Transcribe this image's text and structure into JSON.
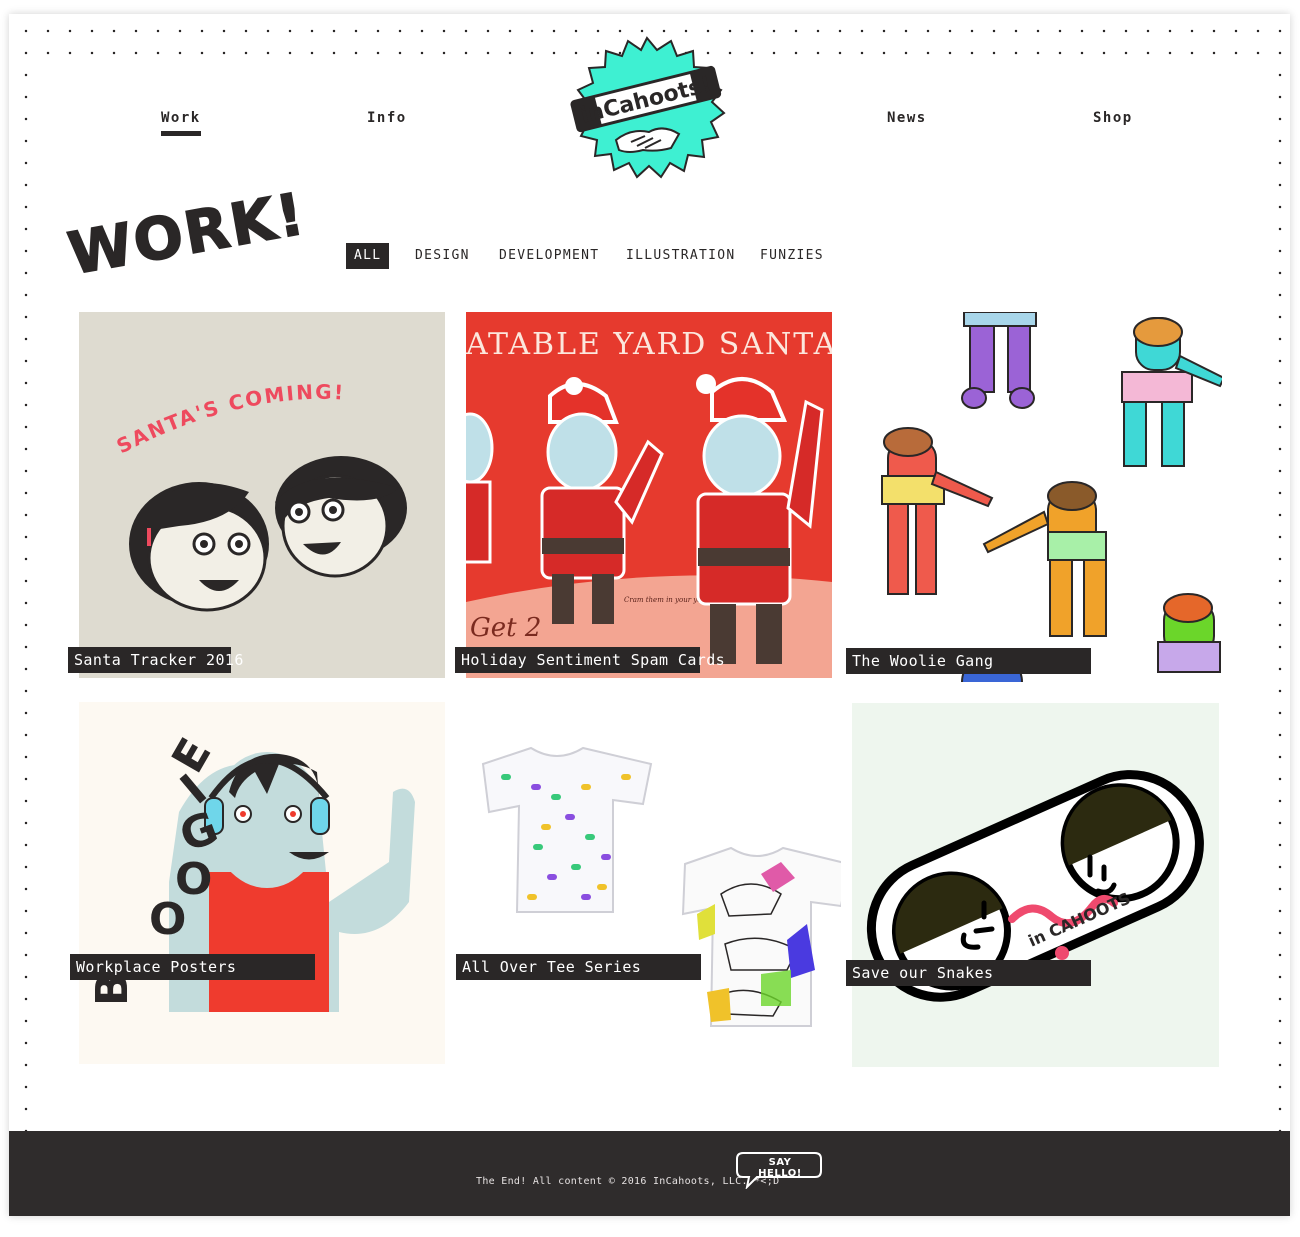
{
  "nav": {
    "work": "Work",
    "info": "Info",
    "news": "News",
    "shop": "Shop"
  },
  "logo": {
    "text": "inCahoots!",
    "accent": "#3ef0d2"
  },
  "heading": "WORK!",
  "filters": [
    "ALL",
    "DESIGN",
    "DEVELOPMENT",
    "ILLUSTRATION",
    "FUNZIES"
  ],
  "tiles": [
    {
      "title": "Santa Tracker 2016",
      "art_text": "SANTA'S COMING!"
    },
    {
      "title": "Holiday Sentiment Spam Cards",
      "art_text": "ATABLE YARD SANTA",
      "art_subtext": "Get 2",
      "art_note": "Cram them in your yard!"
    },
    {
      "title": "The Woolie Gang"
    },
    {
      "title": "Workplace Posters",
      "art_text": "BOOGIE"
    },
    {
      "title": "All Over Tee Series"
    },
    {
      "title": "Save our Snakes",
      "art_text": "in CAHOOTS"
    }
  ],
  "footer": {
    "copyright": "The End! All content © 2016 InCahoots, LLC. *<;D",
    "say_hello": "SAY HELLO!"
  },
  "colors": {
    "ink": "#2a2727",
    "footer_bg": "#2f2c2c",
    "teal": "#3ef0d2",
    "santa_red": "#e63a2e",
    "tile_beige": "#dedbd0",
    "tile_cream": "#fdf9f2",
    "tile_mint": "#eef6ee"
  }
}
